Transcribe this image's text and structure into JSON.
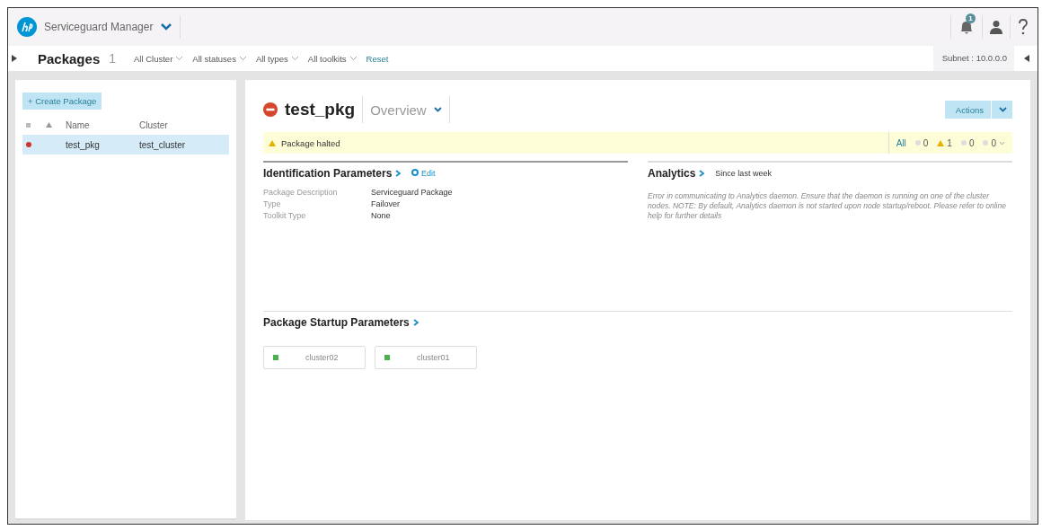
{
  "header": {
    "app_title": "Serviceguard Manager",
    "notification_count": "1"
  },
  "toolbar": {
    "title": "Packages",
    "count": "1",
    "filters": [
      "All Cluster",
      "All statuses",
      "All types",
      "All toolkits"
    ],
    "reset": "Reset",
    "subnet": "Subnet : 10.0.0.0"
  },
  "sidebar": {
    "create_button": "+ Create Package",
    "columns": [
      "Name",
      "Cluster"
    ],
    "rows": [
      {
        "name": "test_pkg",
        "cluster": "test_cluster",
        "selected": true,
        "color": "#d0342c"
      }
    ]
  },
  "detail": {
    "title": "test_pkg",
    "view": "Overview",
    "actions": "Actions",
    "alert": "Package halted",
    "counts": [
      {
        "kind": "all",
        "label": "All"
      },
      {
        "kind": "dot",
        "label": "0"
      },
      {
        "kind": "warning",
        "label": "1"
      },
      {
        "kind": "dot",
        "label": "0"
      },
      {
        "kind": "menu",
        "label": "0"
      }
    ],
    "identification": {
      "title": "Identification Parameters",
      "edit": "Edit",
      "params": [
        {
          "label": "Package Description",
          "value": "Serviceguard Package"
        },
        {
          "label": "Type",
          "value": "Failover"
        },
        {
          "label": "Toolkit Type",
          "value": "None"
        }
      ]
    },
    "analytics": {
      "title": "Analytics",
      "subtitle": "Since last week",
      "message": "Error in communicating to Analytics daemon. Ensure that the daemon is running on one of the cluster nodes. NOTE: By default, Analytics daemon is not started upon node startup/reboot. Please refer to online help for further details"
    },
    "startup": {
      "title": "Package Startup Parameters",
      "nodes": [
        {
          "name": "cluster02",
          "color": "#4caf50"
        },
        {
          "name": "cluster01",
          "color": "#4caf50"
        }
      ]
    }
  }
}
